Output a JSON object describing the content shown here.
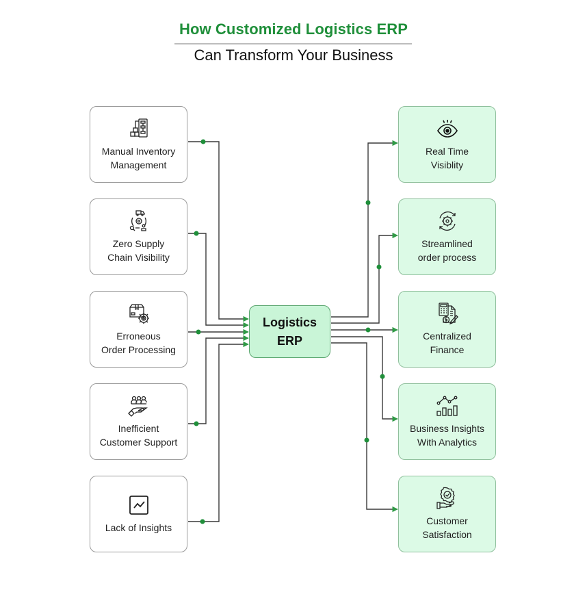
{
  "title": {
    "line1": "How Customized Logistics ERP",
    "line2": "Can Transform Your Business"
  },
  "colors": {
    "accent_green": "#1f8f3a",
    "connector_dot": "#1f8f3a",
    "right_card_bg": "#dcfae6",
    "center_bg": "#c9f5d7",
    "line": "#3a3a3a"
  },
  "center": {
    "line1": "Logistics",
    "line2": "ERP"
  },
  "problems": [
    {
      "icon": "inventory-flowchart-icon",
      "line1": "Manual Inventory",
      "line2": "Management"
    },
    {
      "icon": "supply-chain-cycle-icon",
      "line1": "Zero Supply",
      "line2": "Chain Visibility"
    },
    {
      "icon": "package-gear-icon",
      "line1": "Erroneous",
      "line2": "Order Processing"
    },
    {
      "icon": "team-hand-support-icon",
      "line1": "Inefficient",
      "line2": "Customer Support"
    },
    {
      "icon": "line-chart-box-icon",
      "line1": "Lack of Insights",
      "line2": ""
    }
  ],
  "benefits": [
    {
      "icon": "eye-icon",
      "line1": "Real Time",
      "line2": "Visiblity"
    },
    {
      "icon": "gear-refresh-icon",
      "line1": "Streamlined",
      "line2": "order process"
    },
    {
      "icon": "calculator-invoice-icon",
      "line1": "Centralized",
      "line2": "Finance"
    },
    {
      "icon": "analytics-bars-icon",
      "line1": "Business Insights",
      "line2": "With Analytics"
    },
    {
      "icon": "hand-badge-check-icon",
      "line1": "Customer",
      "line2": "Satisfaction"
    }
  ]
}
